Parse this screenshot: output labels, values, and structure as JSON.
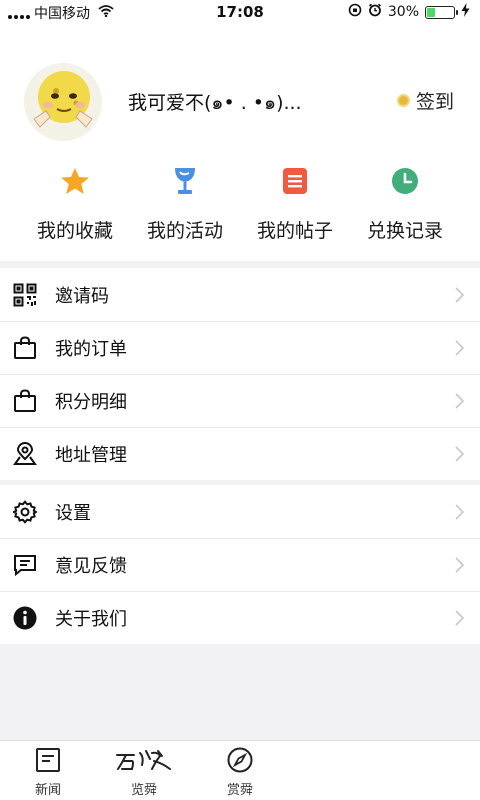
{
  "status_bar": {
    "carrier": "中国移动",
    "time": "17:08",
    "battery_text": "30%",
    "battery_level": 0.3
  },
  "profile": {
    "username": "我可爱不(๑• . •๑)...",
    "checkin_label": "签到"
  },
  "quick_actions": [
    {
      "label": "我的收藏",
      "icon": "star-icon",
      "color": "#f5a623"
    },
    {
      "label": "我的活动",
      "icon": "trophy-cup-icon",
      "color": "#4a90e2"
    },
    {
      "label": "我的帖子",
      "icon": "document-icon",
      "color": "#f05a3e"
    },
    {
      "label": "兑换记录",
      "icon": "clock-icon",
      "color": "#3fae7a"
    }
  ],
  "menu_group_1": [
    {
      "label": "邀请码",
      "icon": "qr-code-icon"
    },
    {
      "label": "我的订单",
      "icon": "shopping-bag-icon"
    },
    {
      "label": "积分明细",
      "icon": "shopping-bag-icon"
    },
    {
      "label": "地址管理",
      "icon": "location-pin-icon"
    }
  ],
  "menu_group_2": [
    {
      "label": "设置",
      "icon": "gear-icon"
    },
    {
      "label": "意见反馈",
      "icon": "feedback-icon"
    },
    {
      "label": "关于我们",
      "icon": "info-icon"
    }
  ],
  "tabbar": {
    "tabs": [
      {
        "label": "新闻",
        "icon": "news-icon"
      },
      {
        "label": "览舜",
        "icon": "brand-logo"
      },
      {
        "label": "赏舜",
        "icon": "compass-icon"
      }
    ]
  }
}
